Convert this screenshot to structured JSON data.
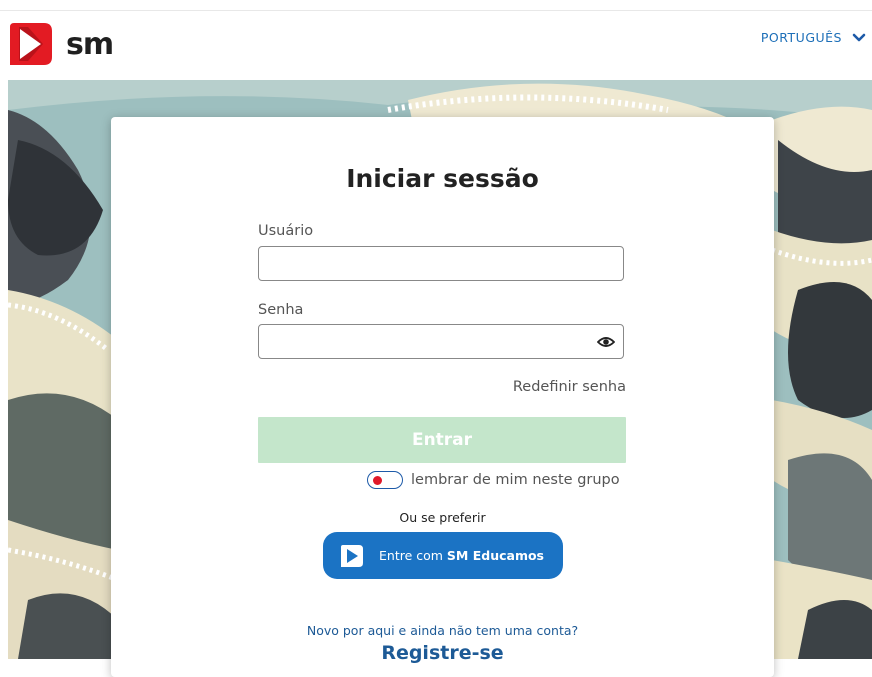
{
  "header": {
    "logo_text": "sm",
    "language_label": "PORTUGUÊS",
    "brand_red": "#e31b23"
  },
  "login": {
    "title": "Iniciar sessão",
    "username_label": "Usuário",
    "username_value": "",
    "password_label": "Senha",
    "password_value": "",
    "forgot_password": "Redefinir senha",
    "submit_label": "Entrar",
    "remember_label": "lembrar de mim neste grupo",
    "alt_prompt": "Ou se preferir",
    "sso_prefix": "Entre com ",
    "sso_brand": "SM Educamos",
    "new_user_prompt": "Novo por aqui e ainda não tem uma conta?",
    "register_label": "Registre-se"
  },
  "icons": {
    "language_toggle": "chevron-down-icon",
    "password_visibility": "eye-icon",
    "sso": "sm-logo-icon"
  }
}
